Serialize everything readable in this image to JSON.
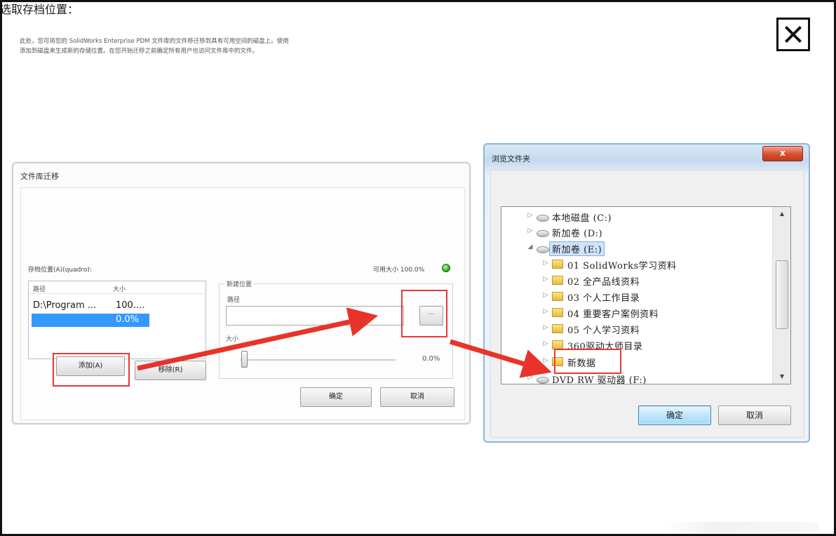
{
  "left_dialog": {
    "title": "文件库迁移",
    "description_line1": "此处，您可将您的 SolidWorks Enterprise PDM 文件库的文件移迁移到具有可用空间的磁盘上。使用",
    "description_line2": "添加到磁盘来生成新的存储位置。在您开始迁移之前确定所有用户也访问文件库中的文件。",
    "storage_label": "存档位置(A)(quadro):",
    "free_space_label": "可用大小 100.0%",
    "list": {
      "columns": [
        "路径",
        "大小"
      ],
      "rows": [
        {
          "path": "D:\\Program ...",
          "size": "100...."
        },
        {
          "path": "",
          "size": "0.0%"
        }
      ],
      "selected_row": 1
    },
    "add_button": "添加(A)",
    "remove_button": "移除(R)",
    "new_location_group": "新建位置",
    "path_label": "路径",
    "path_value": "",
    "size_label": "大小",
    "size_percent": "0.0%",
    "size_slider_fraction": 0.0,
    "ok_button": "确定",
    "cancel_button": "取消"
  },
  "right_dialog": {
    "title": "浏览文件夹",
    "close_label": "x",
    "prompt": "选取存档位置：",
    "tree": [
      {
        "label": "本地磁盘 (C:)",
        "icon": "drive-icon",
        "arrow": "▷",
        "indent": 0
      },
      {
        "label": "新加卷 (D:)",
        "icon": "drive-icon",
        "arrow": "▷",
        "indent": 0
      },
      {
        "label": "新加卷 (E:)",
        "icon": "drive-icon",
        "arrow": "◢",
        "indent": 0,
        "selected": true
      },
      {
        "label": "01 SolidWorks学习资料",
        "icon": "folder-icon",
        "arrow": "▷",
        "indent": 1
      },
      {
        "label": "02 全产品线资料",
        "icon": "folder-icon",
        "arrow": "▷",
        "indent": 1
      },
      {
        "label": "03 个人工作目录",
        "icon": "folder-icon",
        "arrow": "▷",
        "indent": 1
      },
      {
        "label": "04 重要客户案例资料",
        "icon": "folder-icon",
        "arrow": "▷",
        "indent": 1
      },
      {
        "label": "05 个人学习资料",
        "icon": "folder-icon",
        "arrow": "▷",
        "indent": 1
      },
      {
        "label": "360驱动大师目录",
        "icon": "folder-icon",
        "arrow": "▷",
        "indent": 1
      },
      {
        "label": "新数据",
        "icon": "folder-icon",
        "arrow": "▷",
        "indent": 1
      },
      {
        "label": "DVD RW 驱动器 (F:)",
        "icon": "drive-icon",
        "arrow": "▷",
        "indent": 0
      }
    ],
    "ok_button": "确定",
    "cancel_button": "取消"
  },
  "colors": {
    "highlight": "#e53935",
    "selection": "#3399ff",
    "arrow": "#e8332a"
  }
}
